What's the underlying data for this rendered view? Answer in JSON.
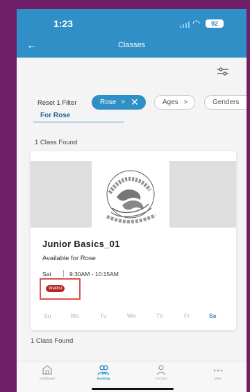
{
  "status_bar": {
    "time": "1:23",
    "battery": "92"
  },
  "nav": {
    "title": "Classes"
  },
  "filters": {
    "reset_label": "Reset 1 Filter",
    "active_chip": "Rose",
    "chips": [
      "Ages",
      "Genders"
    ]
  },
  "tab": {
    "label": "For Rose"
  },
  "results": {
    "count_text": "1 Class Found",
    "count_text_bottom": "1 Class Found"
  },
  "class_card": {
    "name": "Junior Basics_01",
    "availability": "Available for Rose",
    "day": "Sat",
    "time": "9:30AM - 10:15AM",
    "status_badge": "Waitlist",
    "weekdays": [
      "Su",
      "Mo",
      "Tu",
      "We",
      "Th",
      "Fr",
      "Sa"
    ],
    "active_day": "Sa"
  },
  "bottom_nav": {
    "items": [
      {
        "label": "Dashboard",
        "icon": "home-icon"
      },
      {
        "label": "Booking",
        "icon": "booking-icon"
      },
      {
        "label": "Account",
        "icon": "person-icon"
      },
      {
        "label": "More",
        "icon": "more-icon"
      }
    ],
    "active": "Booking"
  },
  "colors": {
    "accent": "#2f8fc6",
    "waitlist": "#b82525",
    "highlight_box": "#d9534f",
    "frame": "#6d1f68"
  }
}
